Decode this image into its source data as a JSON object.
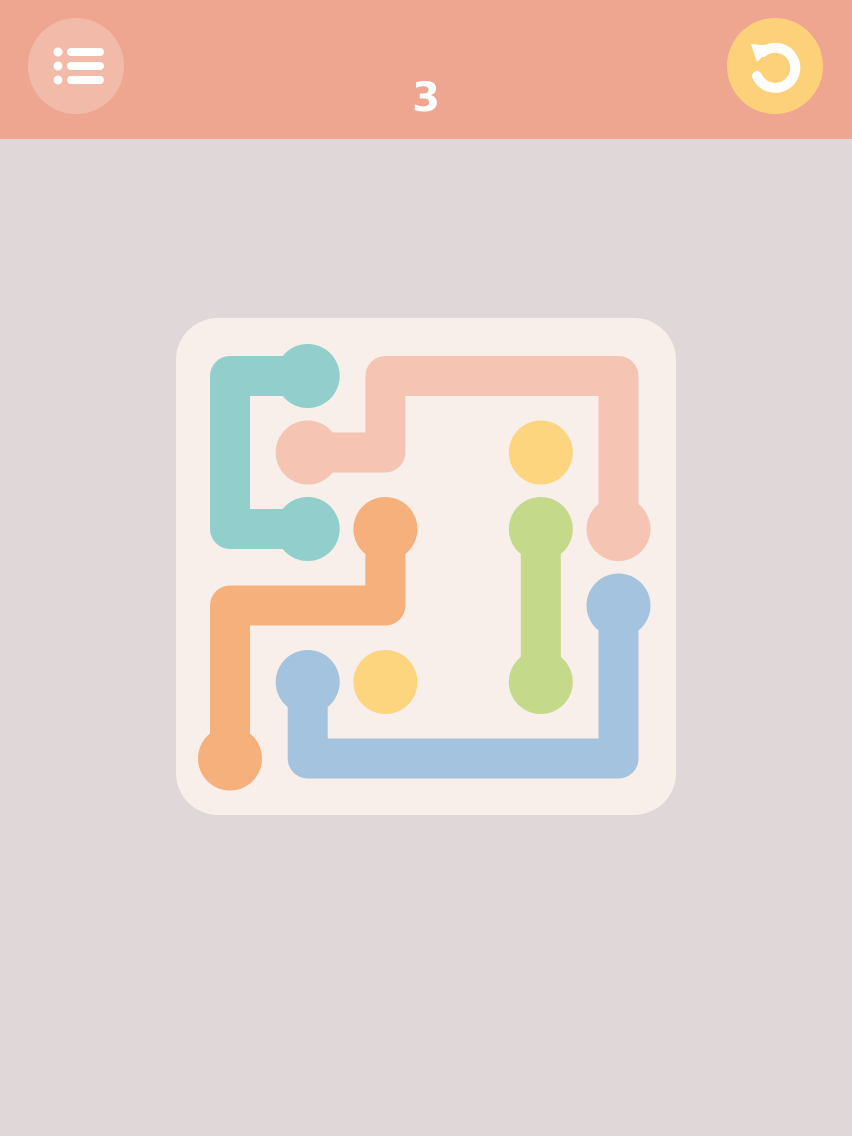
{
  "header": {
    "level_number": "3",
    "menu_icon": "list-icon",
    "undo_icon": "undo-icon"
  },
  "colors": {
    "header_bg": "#eea690",
    "page_bg": "#e0d8d8",
    "board_bg": "#f8eeea",
    "menu_button_bg": "#f2bba9",
    "undo_button_bg": "#fdd07a"
  },
  "board": {
    "grid_size": 6,
    "flows": [
      {
        "color_name": "teal",
        "color": "#92cfcc",
        "endpoints": [
          [
            1,
            0
          ],
          [
            1,
            2
          ]
        ],
        "path": [
          [
            1,
            0
          ],
          [
            0,
            0
          ],
          [
            0,
            1
          ],
          [
            0,
            2
          ],
          [
            1,
            2
          ]
        ],
        "complete": true
      },
      {
        "color_name": "pink",
        "color": "#f5c4b3",
        "endpoints": [
          [
            1,
            1
          ],
          [
            5,
            2
          ]
        ],
        "path": [
          [
            1,
            1
          ],
          [
            2,
            1
          ],
          [
            2,
            0
          ],
          [
            3,
            0
          ],
          [
            4,
            0
          ],
          [
            5,
            0
          ],
          [
            5,
            1
          ],
          [
            5,
            2
          ]
        ],
        "complete": true
      },
      {
        "color_name": "orange",
        "color": "#f6b07c",
        "endpoints": [
          [
            2,
            2
          ],
          [
            0,
            5
          ]
        ],
        "path": [
          [
            2,
            2
          ],
          [
            2,
            3
          ],
          [
            1,
            3
          ],
          [
            0,
            3
          ],
          [
            0,
            4
          ],
          [
            0,
            5
          ]
        ],
        "complete": true
      },
      {
        "color_name": "green",
        "color": "#c4da8a",
        "endpoints": [
          [
            4,
            2
          ],
          [
            4,
            4
          ]
        ],
        "path": [
          [
            4,
            2
          ],
          [
            4,
            3
          ],
          [
            4,
            4
          ]
        ],
        "complete": true
      },
      {
        "color_name": "blue",
        "color": "#a3c3de",
        "endpoints": [
          [
            1,
            4
          ],
          [
            5,
            3
          ]
        ],
        "path": [
          [
            1,
            4
          ],
          [
            1,
            5
          ],
          [
            2,
            5
          ],
          [
            3,
            5
          ],
          [
            4,
            5
          ],
          [
            5,
            5
          ],
          [
            5,
            4
          ],
          [
            5,
            3
          ]
        ],
        "complete": true
      },
      {
        "color_name": "yellow",
        "color": "#fdd57e",
        "endpoints": [
          [
            4,
            1
          ],
          [
            2,
            4
          ]
        ],
        "path": [],
        "complete": false
      }
    ]
  }
}
